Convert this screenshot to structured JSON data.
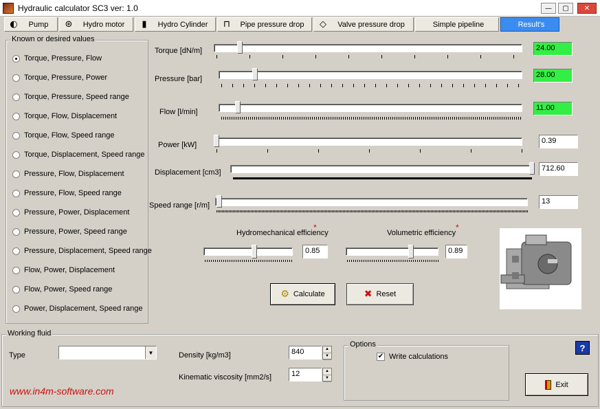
{
  "window": {
    "title": "Hydraulic calculator SC3  ver: 1.0",
    "min": "—",
    "max": "▢",
    "close": "✕"
  },
  "tabs": [
    {
      "label": "Pump",
      "icon": "pump-icon"
    },
    {
      "label": "Hydro motor",
      "icon": "motor-icon"
    },
    {
      "label": "Hydro Cylinder",
      "icon": "cylinder-icon"
    },
    {
      "label": "Pipe pressure drop",
      "icon": "pipe-icon"
    },
    {
      "label": "Valve pressure drop",
      "icon": "valve-icon"
    },
    {
      "label": "Simple pipeline",
      "icon": ""
    },
    {
      "label": "Result's",
      "icon": ""
    }
  ],
  "known": {
    "title": "Known or desired values",
    "selected": 0,
    "options": [
      "Torque, Pressure, Flow",
      "Torque, Pressure, Power",
      "Torque, Pressure, Speed range",
      "Torque, Flow, Displacement",
      "Torque, Flow, Speed range",
      "Torque, Displacement, Speed range",
      "Pressure, Flow, Displacement",
      "Pressure, Flow, Speed range",
      "Pressure, Power, Displacement",
      "Pressure, Power, Speed range",
      "Pressure, Displacement, Speed range",
      "Flow, Power, Displacement",
      "Flow, Power, Speed range",
      "Power, Displacement, Speed range"
    ]
  },
  "params": {
    "torque": {
      "label": "Torque [dN/m]",
      "value": "24.00"
    },
    "pressure": {
      "label": "Pressure [bar]",
      "value": "28.00"
    },
    "flow": {
      "label": "Flow [l/min]",
      "value": "11.00"
    },
    "power": {
      "label": "Power [kW]",
      "value": "0.39"
    },
    "displacement": {
      "label": "Displacement [cm3]",
      "value": "712.60"
    },
    "speed": {
      "label": "Speed range [r/m]",
      "value": "13"
    }
  },
  "efficiency": {
    "hydromechanical": {
      "label": "Hydromechanical efficiency",
      "value": "0.85"
    },
    "volumetric": {
      "label": "Volumetric efficiency",
      "value": "0.89"
    },
    "required_mark": "*"
  },
  "buttons": {
    "calculate": "Calculate",
    "reset": "Reset",
    "exit": "Exit",
    "help": "?"
  },
  "fluid": {
    "title": "Working fluid",
    "type_label": "Type",
    "type_value": "",
    "density_label": "Density [kg/m3]",
    "density_value": "840",
    "viscosity_label": "Kinematic viscosity [mm2/s]",
    "viscosity_value": "12"
  },
  "options": {
    "title": "Options",
    "write_calculations": "Write calculations",
    "checked": true
  },
  "footer": {
    "url": "www.in4m-software.com"
  },
  "colors": {
    "result_green": "#33ee44",
    "active_tab": "#3b8cf0",
    "url_red": "#cc1111"
  }
}
